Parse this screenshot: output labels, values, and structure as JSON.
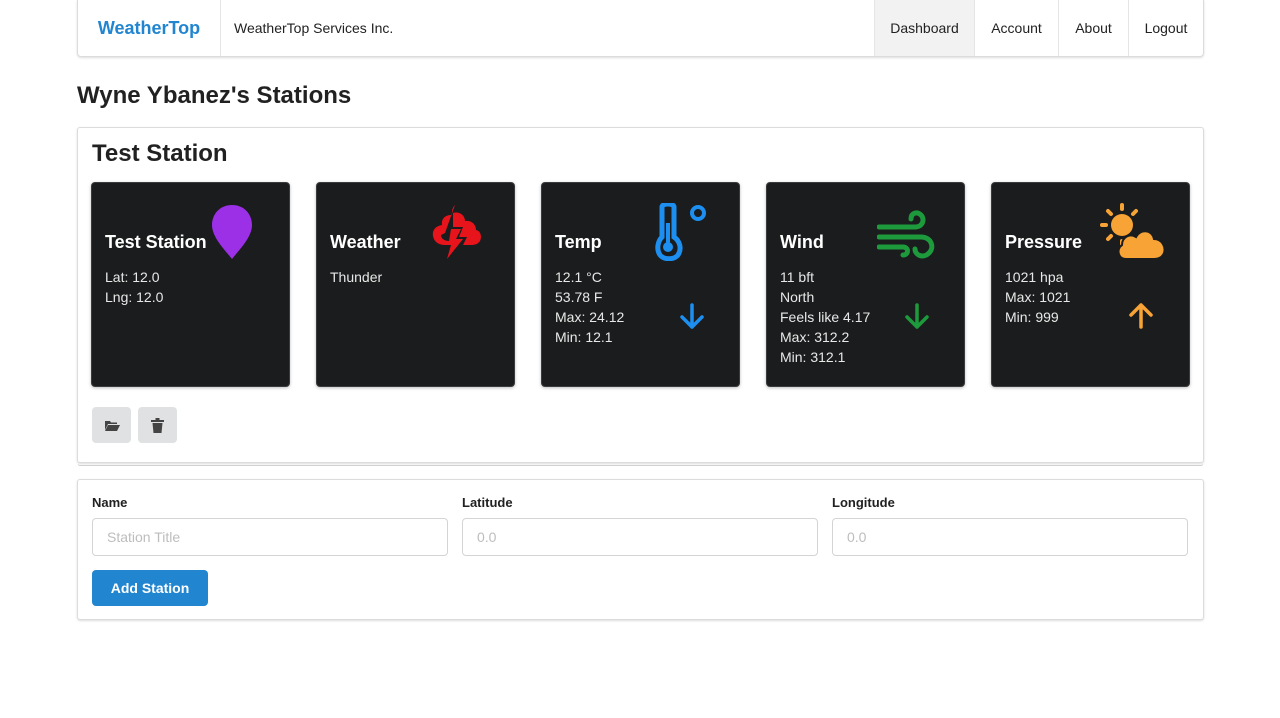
{
  "nav": {
    "brand": "WeatherTop",
    "company": "WeatherTop Services Inc.",
    "items": [
      {
        "label": "Dashboard",
        "active": true
      },
      {
        "label": "Account",
        "active": false
      },
      {
        "label": "About",
        "active": false
      },
      {
        "label": "Logout",
        "active": false
      }
    ]
  },
  "page_title": "Wyne Ybanez's Stations",
  "station": {
    "title": "Test Station",
    "cards": [
      {
        "title": "Test Station",
        "icon": "map-marker-icon",
        "icon_color": "#9b30e6",
        "lines": [
          "Lat: 12.0",
          "Lng: 12.0"
        ]
      },
      {
        "title": "Weather",
        "icon": "thunder-cloud-icon",
        "icon_color": "#e8141c",
        "lines": [
          "Thunder"
        ]
      },
      {
        "title": "Temp",
        "icon": "thermometer-icon",
        "icon_color": "#1d8ff0",
        "lines": [
          "12.1 °C",
          "53.78 F",
          "Max: 24.12",
          "Min: 12.1"
        ],
        "trend": "down",
        "trend_color": "#1d8ff0"
      },
      {
        "title": "Wind",
        "icon": "wind-icon",
        "icon_color": "#1d9b3c",
        "lines": [
          "11 bft",
          "North",
          "Feels like 4.17",
          "Max: 312.2",
          "Min: 312.1"
        ],
        "trend": "down",
        "trend_color": "#1d9b3c"
      },
      {
        "title": "Pressure",
        "icon": "sun-cloud-icon",
        "icon_color": "#f7a335",
        "lines": [
          "1021 hpa",
          "Max: 1021",
          "Min: 999"
        ],
        "trend": "up",
        "trend_color": "#f7a335"
      }
    ],
    "actions": [
      "folder-open-icon",
      "trash-icon"
    ]
  },
  "form": {
    "name_label": "Name",
    "name_placeholder": "Station Title",
    "lat_label": "Latitude",
    "lat_placeholder": "0.0",
    "lng_label": "Longitude",
    "lng_placeholder": "0.0",
    "submit_label": "Add Station"
  },
  "colors": {
    "accent": "#2185d0",
    "card_bg": "#1b1c1d"
  }
}
